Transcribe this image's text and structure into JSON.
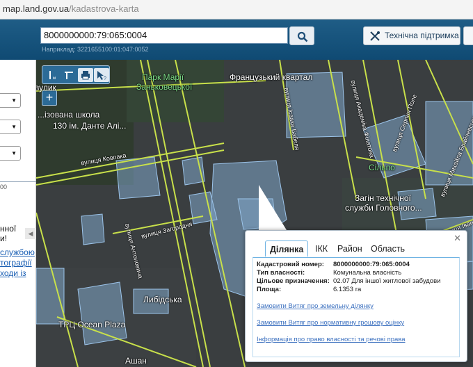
{
  "browser": {
    "url_host": "map.land.gov.ua",
    "url_path": "/kadastrova-karta"
  },
  "header": {
    "search_value": "8000000000:79:065:0004",
    "search_hint": "Наприклад: 3221655100:01:047:0052",
    "support_label": "Технічна підтримка"
  },
  "sidebar": {
    "value_text": "00",
    "text_1": "нної",
    "text_2": "и!",
    "links": [
      "службою",
      "тографії",
      "ходи із"
    ]
  },
  "map": {
    "labels": {
      "park": "Парк Марії",
      "park2": "Заньковецької",
      "quarter": "Французький квартал",
      "school": "...ізована школа",
      "school2": "130 ім. Данте Алі...",
      "silpo": "Сільпо",
      "zagin": "Загін технічної",
      "zagin2": "служби Головного...",
      "lybidska": "Либідська",
      "ocean": "ТРЦ Ocean Plaza",
      "ashan": "Ашан",
      "lodge": "вулик",
      "street_kovpaka": "вулиця Ковпака",
      "street_zagorodnia": "вулиця Загородня",
      "street_antonovycha": "вулиця Антоновича",
      "street_1": "вулиця Академіка Філатова",
      "street_2": "вулиця Ісаака Бабеля",
      "street_3": "вулиця Серпня Поле",
      "street_4": "вулиця Михайла Брайчевського",
      "street_5": "вулиця Івана Кудрі"
    }
  },
  "popup": {
    "tabs": [
      "Ділянка",
      "ІКК",
      "Район",
      "Область"
    ],
    "rows": [
      {
        "key": "Кадастровий номер:",
        "value": "8000000000:79:065:0004"
      },
      {
        "key": "Тип власності:",
        "value": "Комунальна власність"
      },
      {
        "key": "Цільове призначення:",
        "value": "02.07 Для іншої житлової забудови"
      },
      {
        "key": "Площа:",
        "value": "6.1353 га"
      }
    ],
    "links": [
      "Замовити Витяг про земельну ділянку",
      "Замовити Витяг про нормативну грошову оцінку",
      "Інформація про право власності та речові права"
    ]
  }
}
